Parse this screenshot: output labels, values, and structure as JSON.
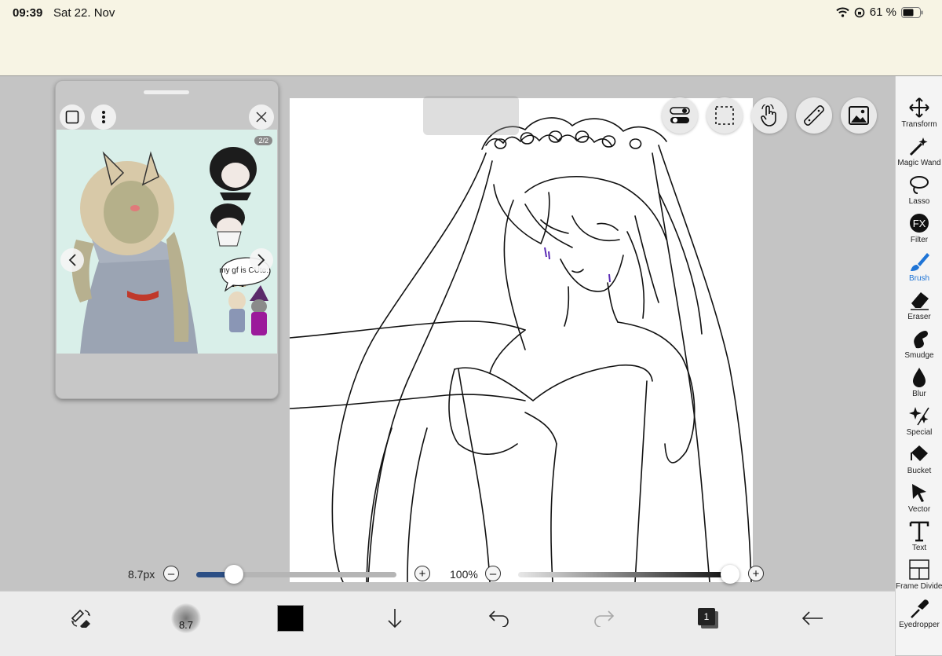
{
  "status_bar": {
    "time": "09:39",
    "date": "Sat 22. Nov",
    "battery": "61 %"
  },
  "reference_panel": {
    "counter": "2/2",
    "sketch_note": "my gf is CUte::"
  },
  "tools": [
    {
      "label": "Transform",
      "icon": "move-arrows-icon"
    },
    {
      "label": "Magic Wand",
      "icon": "magic-wand-icon"
    },
    {
      "label": "Lasso",
      "icon": "lasso-icon"
    },
    {
      "label": "Filter",
      "icon": "fx-icon"
    },
    {
      "label": "Brush",
      "icon": "brush-icon",
      "active": true
    },
    {
      "label": "Eraser",
      "icon": "eraser-icon"
    },
    {
      "label": "Smudge",
      "icon": "smudge-finger-icon"
    },
    {
      "label": "Blur",
      "icon": "droplet-icon"
    },
    {
      "label": "Special",
      "icon": "sparkle-icon"
    },
    {
      "label": "Bucket",
      "icon": "bucket-icon"
    },
    {
      "label": "Vector",
      "icon": "cursor-arrow-icon"
    },
    {
      "label": "Text",
      "icon": "text-t-icon"
    },
    {
      "label": "Frame Divider",
      "icon": "frame-divider-icon"
    },
    {
      "label": "Eyedropper",
      "icon": "eyedropper-icon"
    }
  ],
  "brush_size": {
    "label": "8.7px",
    "value": 0.19
  },
  "opacity": {
    "label": "100%",
    "value": 1.0
  },
  "bottom_bar": {
    "brush_preview_label": "8.7",
    "color": "#000000",
    "layer_count": "1"
  },
  "accent_color": "#1e74d6"
}
